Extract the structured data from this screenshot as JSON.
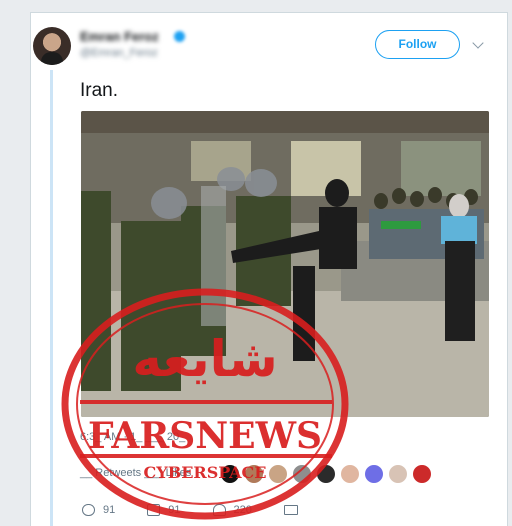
{
  "tweet": {
    "author_name": "Emran Feroz",
    "author_handle": "@Emran_Feroz",
    "follow_label": "Follow",
    "text": "Iran.",
    "timestamp": "6:3_ AM · 1_ ___ 20_",
    "retweets_label": "__ Retweets ___ Likes",
    "reply_count": "91",
    "retweet_count": "91",
    "like_count": "220"
  },
  "stamp": {
    "arabic_text": "شايعه",
    "brand_text": "FARSNEWS",
    "sub_text": "CYBERSPACE",
    "color": "#d81e1e"
  },
  "colors": {
    "accent": "#1da1f2",
    "thread_line": "#cce4f6",
    "muted": "#657786"
  }
}
